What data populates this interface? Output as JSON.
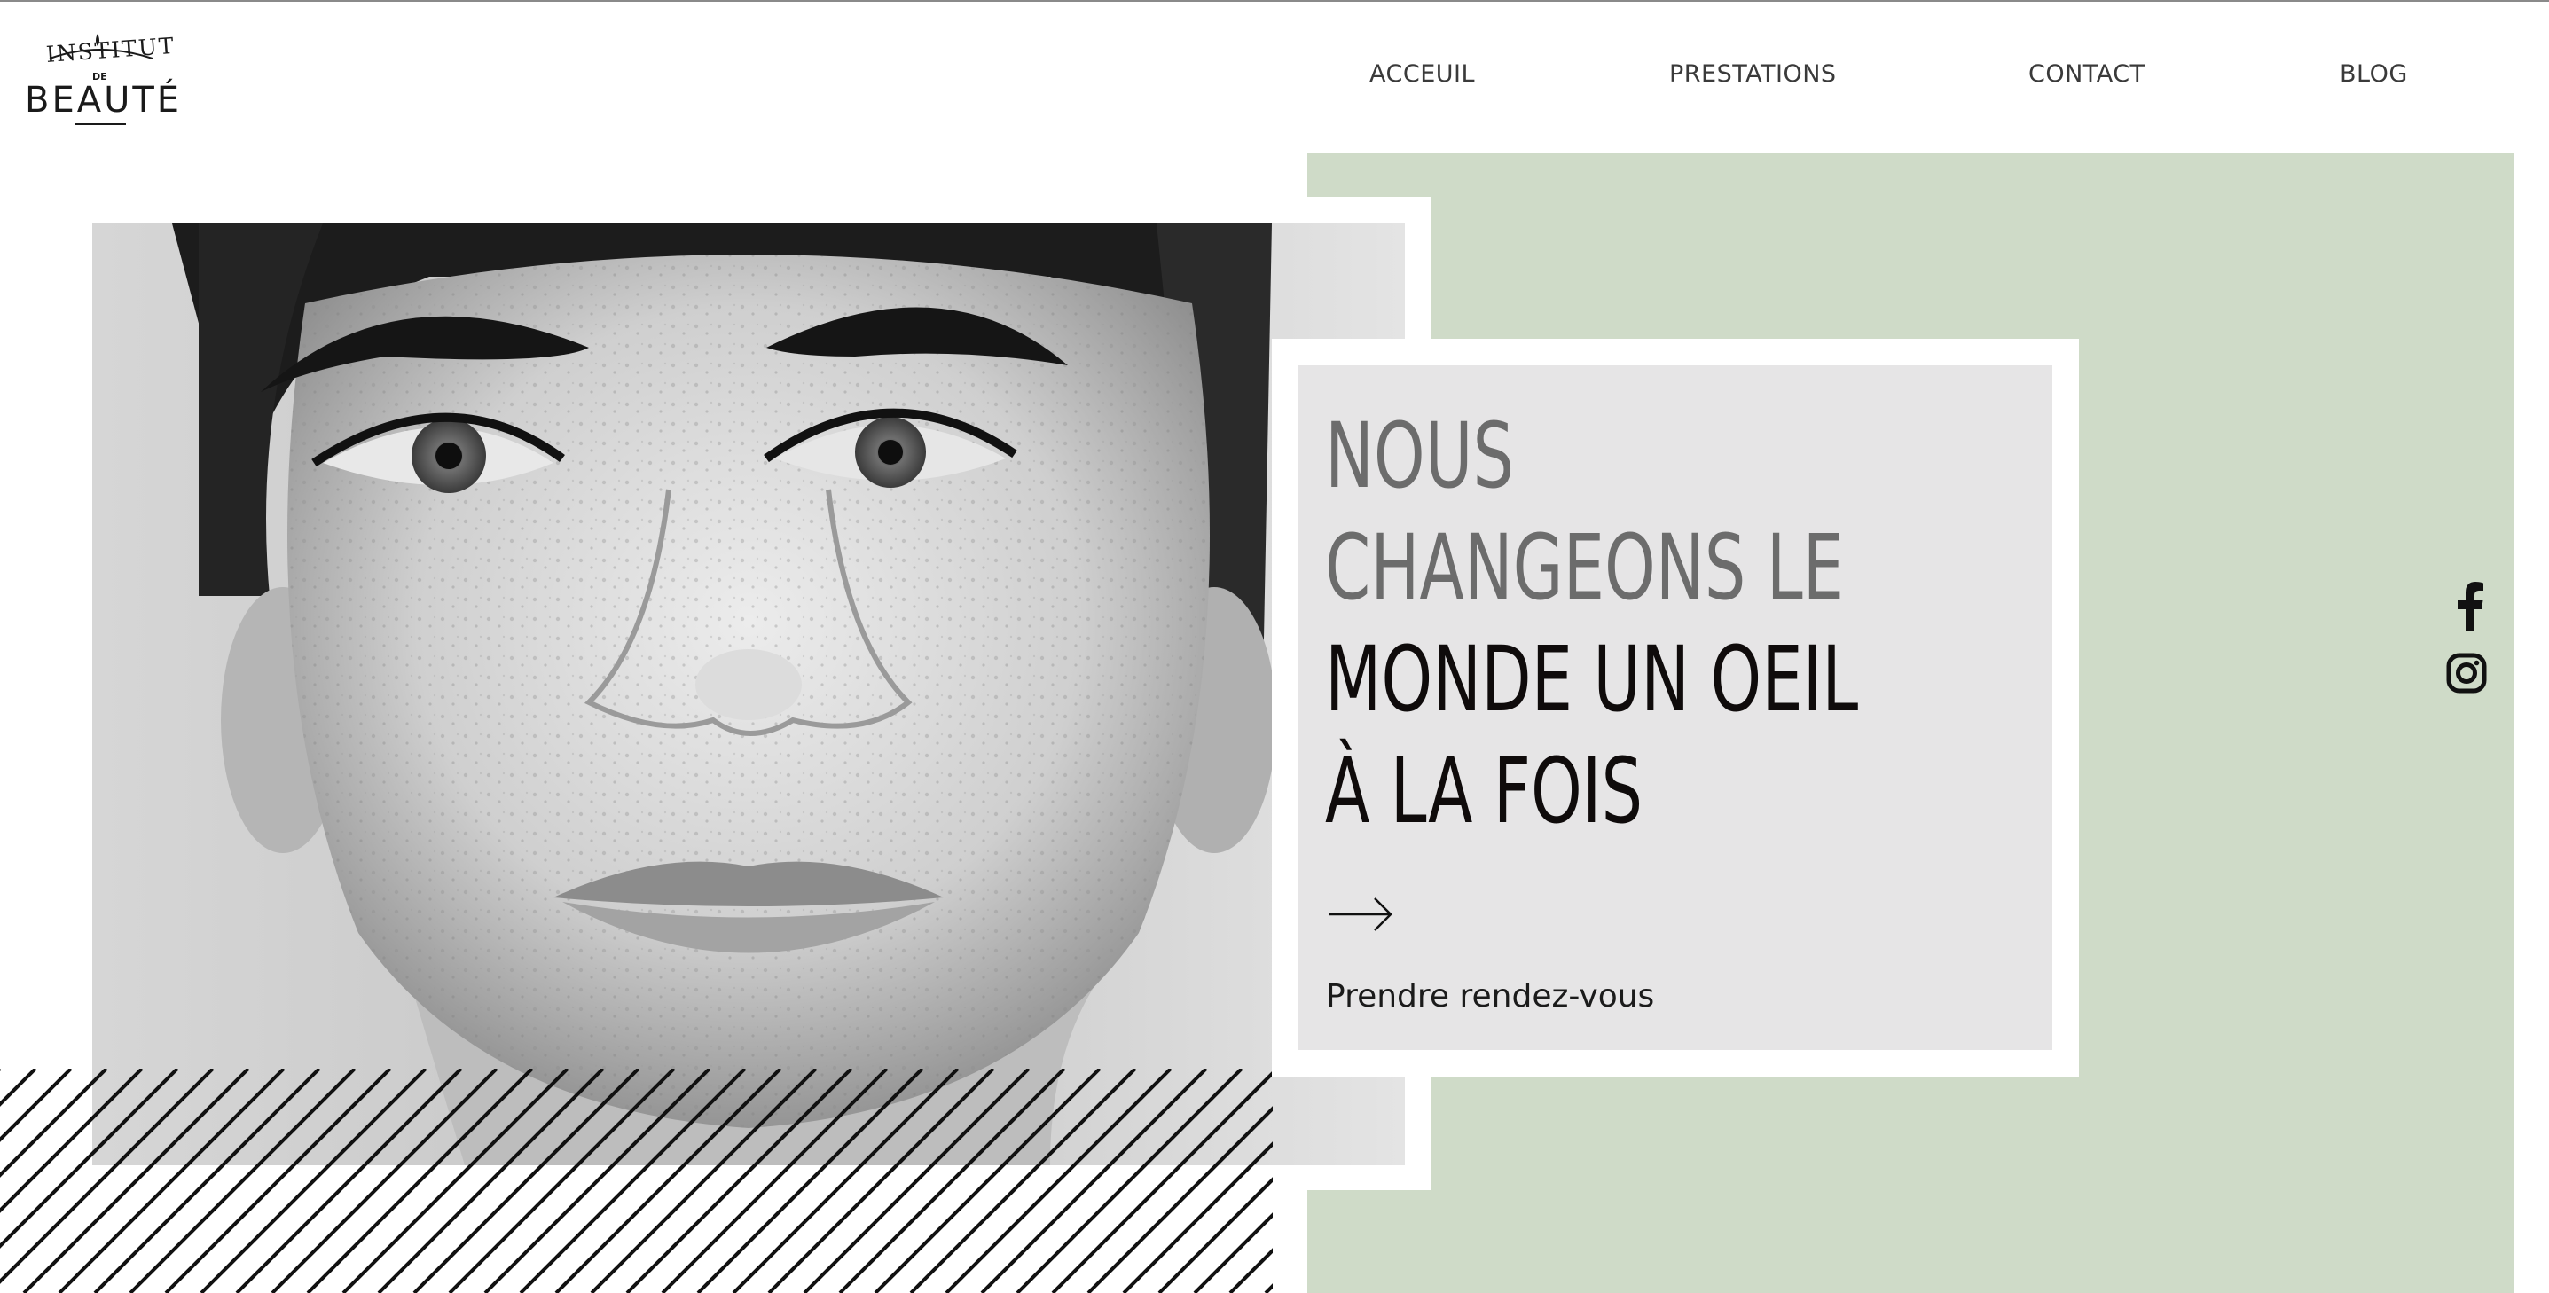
{
  "logo": {
    "line1": "INSTITUT",
    "de": "DE",
    "line2": "BEAUTÉ"
  },
  "nav": {
    "items": [
      {
        "label": "ACCEUIL"
      },
      {
        "label": "PRESTATIONS"
      },
      {
        "label": "CONTACT"
      },
      {
        "label": "BLOG"
      }
    ]
  },
  "hero": {
    "headline_lines": [
      {
        "text": "NOUS",
        "tone": "grey"
      },
      {
        "text": "CHANGEONS LE",
        "tone": "grey"
      },
      {
        "text": "MONDE UN OEIL",
        "tone": "dark"
      },
      {
        "text": "À LA FOIS",
        "tone": "dark"
      }
    ],
    "cta_label": "Prendre rendez-vous",
    "arrow_icon": "arrow-right-icon",
    "photo": "black-and-white close-up portrait of a freckled woman"
  },
  "social": {
    "icons": [
      "facebook-icon",
      "instagram-icon"
    ]
  },
  "colors": {
    "accent_green": "#cfdbc8",
    "card_grey": "#e6e5e6",
    "headline_grey": "#6c6c6c",
    "headline_dark": "#0f0b0b",
    "nav_text": "#3a3a3a"
  }
}
